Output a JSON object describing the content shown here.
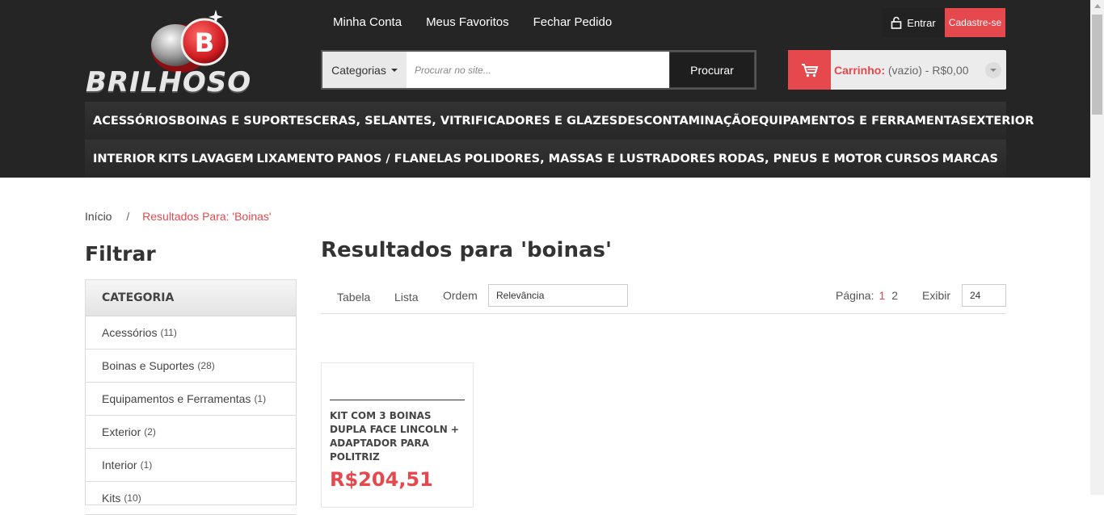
{
  "brand": {
    "name": "BRILHOSO",
    "badge_letter": "B"
  },
  "top_links": [
    "Minha Conta",
    "Meus Favoritos",
    "Fechar Pedido"
  ],
  "auth": {
    "login_label": "Entrar",
    "signup_label": "Cadastre-se"
  },
  "search": {
    "category_label": "Categorias",
    "placeholder": "Procurar no site...",
    "button_label": "Procurar"
  },
  "cart": {
    "label": "Carrinho:",
    "status": "(vazio) - R$0,00"
  },
  "nav": {
    "row1": [
      "ACESSÓRIOS",
      "BOINAS E SUPORTES",
      "CERAS, SELANTES, VITRIFICADORES E GLAZES",
      "DESCONTAMINAÇÃO",
      "EQUIPAMENTOS E FERRAMENTAS",
      "EXTERIOR"
    ],
    "row2": [
      "INTERIOR",
      "KITS",
      "LAVAGEM",
      "LIXAMENTO",
      "PANOS / FLANELAS",
      "POLIDORES, MASSAS E LUSTRADORES",
      "RODAS, PNEUS E MOTOR",
      "CURSOS",
      "MARCAS"
    ]
  },
  "breadcrumb": {
    "home": "Início",
    "separator": "/",
    "current": "Resultados Para: 'Boinas'"
  },
  "filter": {
    "title": "Filtrar",
    "section": "CATEGORIA",
    "items": [
      {
        "label": "Acessórios",
        "count": "(11)"
      },
      {
        "label": "Boinas e Suportes",
        "count": "(28)"
      },
      {
        "label": "Equipamentos e Ferramentas",
        "count": "(1)"
      },
      {
        "label": "Exterior",
        "count": "(2)"
      },
      {
        "label": "Interior",
        "count": "(1)"
      },
      {
        "label": "Kits",
        "count": "(10)"
      }
    ]
  },
  "results": {
    "title": "Resultados para 'boinas'",
    "view_table": "Tabela",
    "view_list": "Lista",
    "sort_label": "Ordem",
    "sort_value": "Relevância",
    "page_label": "Página:",
    "pages": [
      "1",
      "2"
    ],
    "show_label": "Exibir",
    "show_value": "24"
  },
  "products": [
    {
      "name": "KIT COM 3 BOINAS DUPLA FACE LINCOLN + ADAPTADOR PARA POLITRIZ",
      "price": "R$204,51"
    }
  ],
  "colors": {
    "accent": "#e5484d",
    "header_bg": "#252525"
  }
}
